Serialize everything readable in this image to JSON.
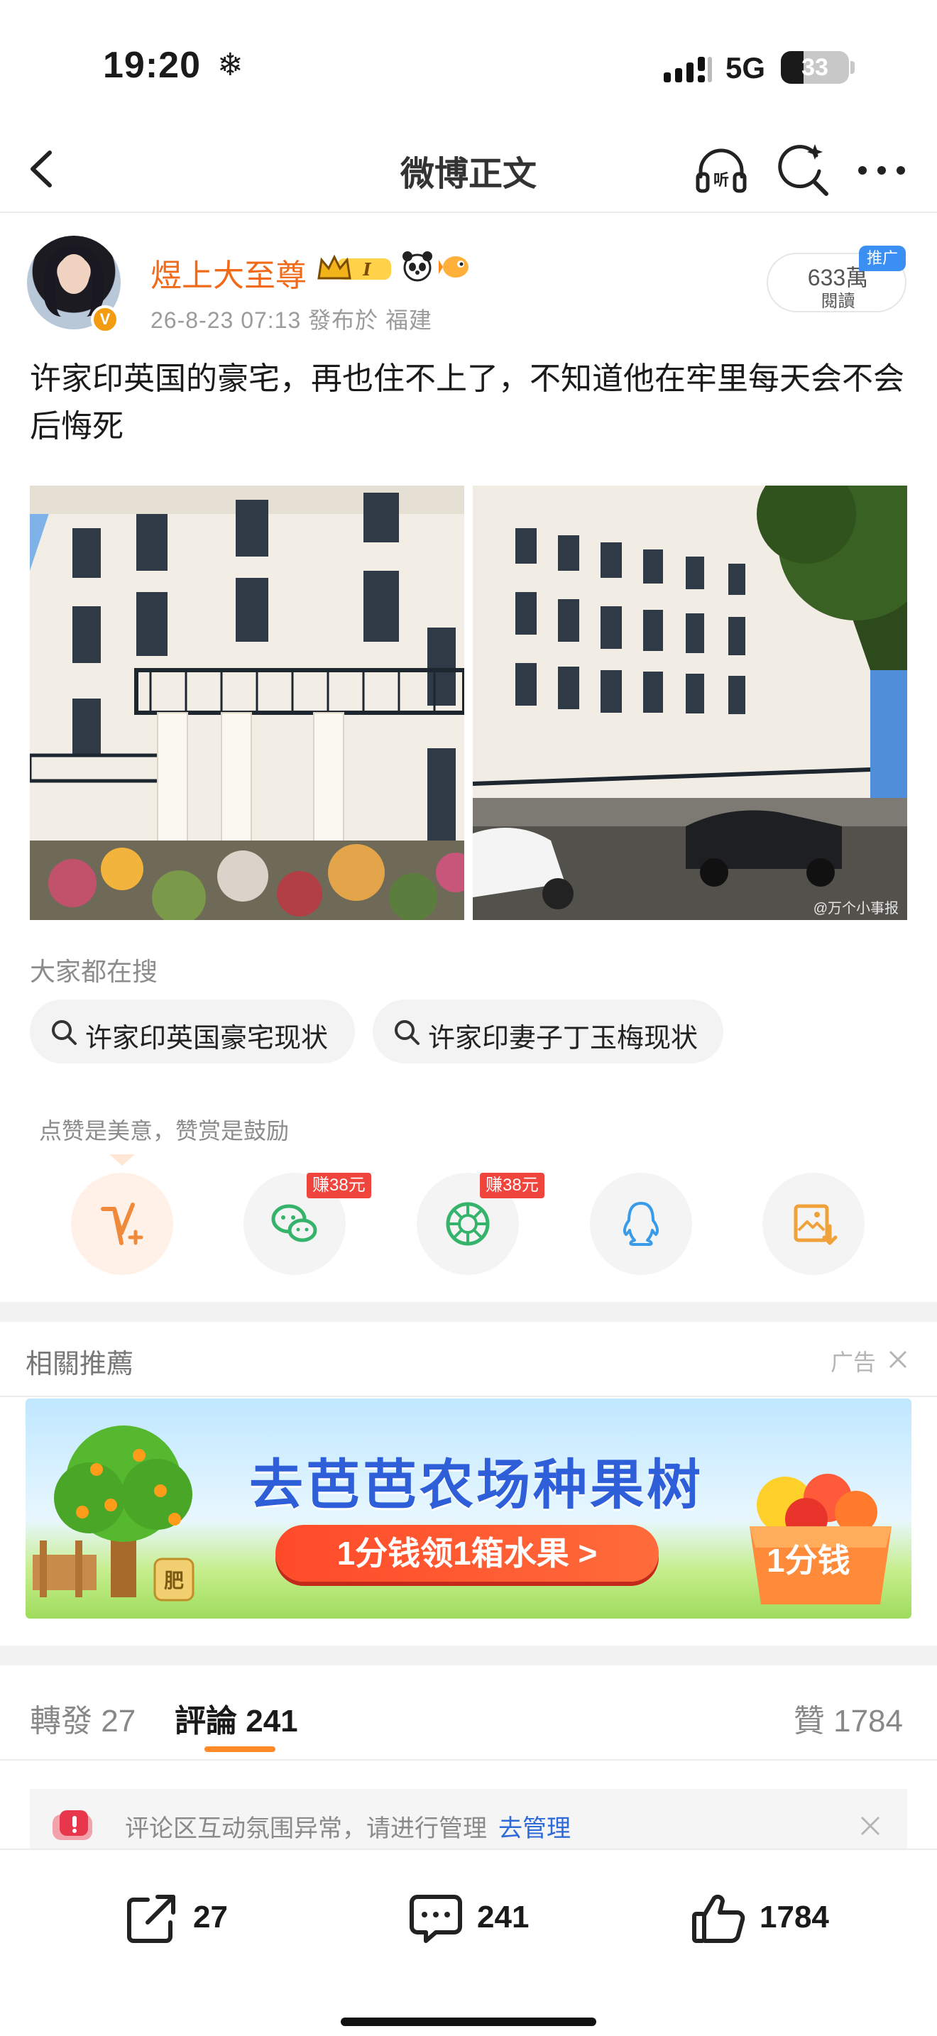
{
  "status_bar": {
    "time": "19:20",
    "weather_icon": "snowflake-icon",
    "network": "5G",
    "battery": "33",
    "battery_level": 0.33
  },
  "nav": {
    "title": "微博正文",
    "icons": [
      "back-chevron-icon",
      "listen-headphones-icon",
      "search-sparkle-icon",
      "more-dots-icon"
    ]
  },
  "post": {
    "username": "煜上大至尊",
    "badge_text": "I",
    "meta": "26-8-23 07:13   發布於 福建",
    "read_count": "633萬",
    "read_label": "閱讀",
    "promo_tag": "推广",
    "text": "许家印英国的豪宅，再也住不上了，不知道他在牢里每天会不会后悔死",
    "image_watermark": "@万个小事报"
  },
  "search": {
    "heading": "大家都在搜",
    "chips": [
      "许家印英国豪宅现状",
      "许家印妻子丁玉梅现状"
    ]
  },
  "reward": {
    "text": "点赞是美意，赞赏是鼓励",
    "earn_badges": [
      "赚38元",
      "赚38元"
    ],
    "share_icons": [
      "v-plus-reward-icon",
      "wechat-icon",
      "moments-icon",
      "qq-icon",
      "save-image-icon"
    ]
  },
  "related": {
    "title": "相關推薦",
    "ad_label": "广告",
    "ad": {
      "headline": "去芭芭农场种果树",
      "cta": "1分钱领1箱水果 >",
      "price": "1分钱",
      "tree_sign": "肥"
    }
  },
  "tabs": {
    "repost_label": "轉發",
    "repost_count": "27",
    "comment_label": "評論",
    "comment_count": "241",
    "like_label": "贊",
    "like_count": "1784"
  },
  "notice": {
    "text": "评论区互动氛围异常，请进行管理",
    "link": "去管理"
  },
  "bottom_bar": {
    "repost": "27",
    "comment": "241",
    "like": "1784"
  },
  "colors": {
    "username": "#f06a1a",
    "accent_orange": "#ff8a2a",
    "link_blue": "#2e6bd8",
    "earn_red": "#f0453c"
  }
}
